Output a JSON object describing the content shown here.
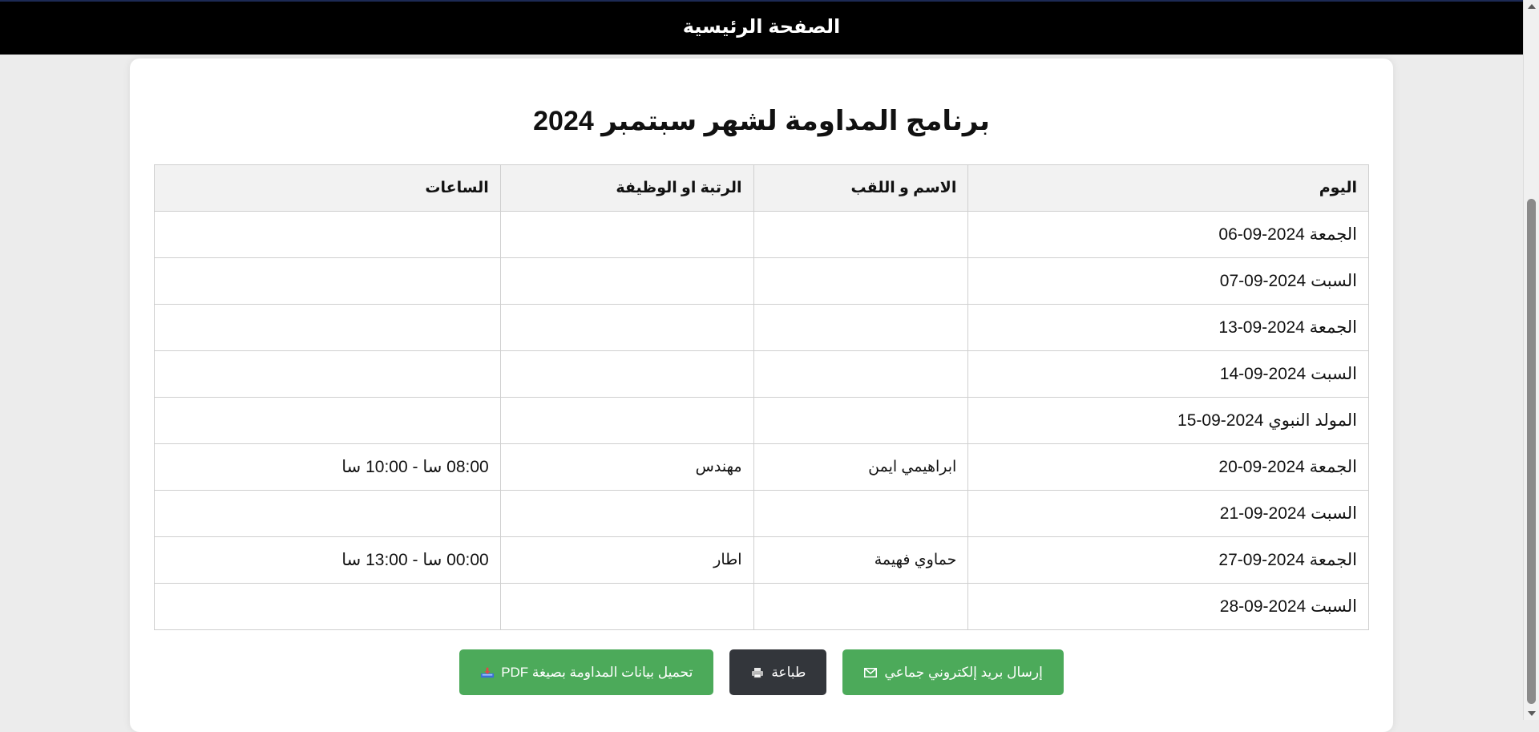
{
  "header": {
    "home_link": "الصفحة الرئيسية"
  },
  "main": {
    "title": "برنامج المداومة لشهر سبتمبر 2024",
    "table": {
      "columns": [
        "اليوم",
        "الاسم و اللقب",
        "الرتبة او الوظيفة",
        "الساعات"
      ],
      "rows": [
        {
          "day": "الجمعة 2024-09-06",
          "name": "",
          "rank": "",
          "hours": ""
        },
        {
          "day": "السبت 2024-09-07",
          "name": "",
          "rank": "",
          "hours": ""
        },
        {
          "day": "الجمعة 2024-09-13",
          "name": "",
          "rank": "",
          "hours": ""
        },
        {
          "day": "السبت 2024-09-14",
          "name": "",
          "rank": "",
          "hours": ""
        },
        {
          "day": "المولد النبوي 2024-09-15",
          "name": "",
          "rank": "",
          "hours": ""
        },
        {
          "day": "الجمعة 2024-09-20",
          "name": "ابراهيمي ايمن",
          "rank": "مهندس",
          "hours": "08:00 سا - 10:00 سا"
        },
        {
          "day": "السبت 2024-09-21",
          "name": "",
          "rank": "",
          "hours": ""
        },
        {
          "day": "الجمعة 2024-09-27",
          "name": "حماوي فهيمة",
          "rank": "اطار",
          "hours": "00:00 سا - 13:00 سا"
        },
        {
          "day": "السبت 2024-09-28",
          "name": "",
          "rank": "",
          "hours": ""
        }
      ]
    },
    "buttons": {
      "email_label": "إرسال بريد إلكتروني جماعي",
      "print_label": "طباعة",
      "pdf_label": "تحميل بيانات المداومة بصيغة PDF"
    }
  },
  "colors": {
    "header_bg": "#000000",
    "button_green": "#4caa5a",
    "button_dark": "#33363b"
  },
  "icons": {
    "email": "envelope-icon",
    "print": "printer-icon",
    "pdf": "download-tray-icon"
  }
}
